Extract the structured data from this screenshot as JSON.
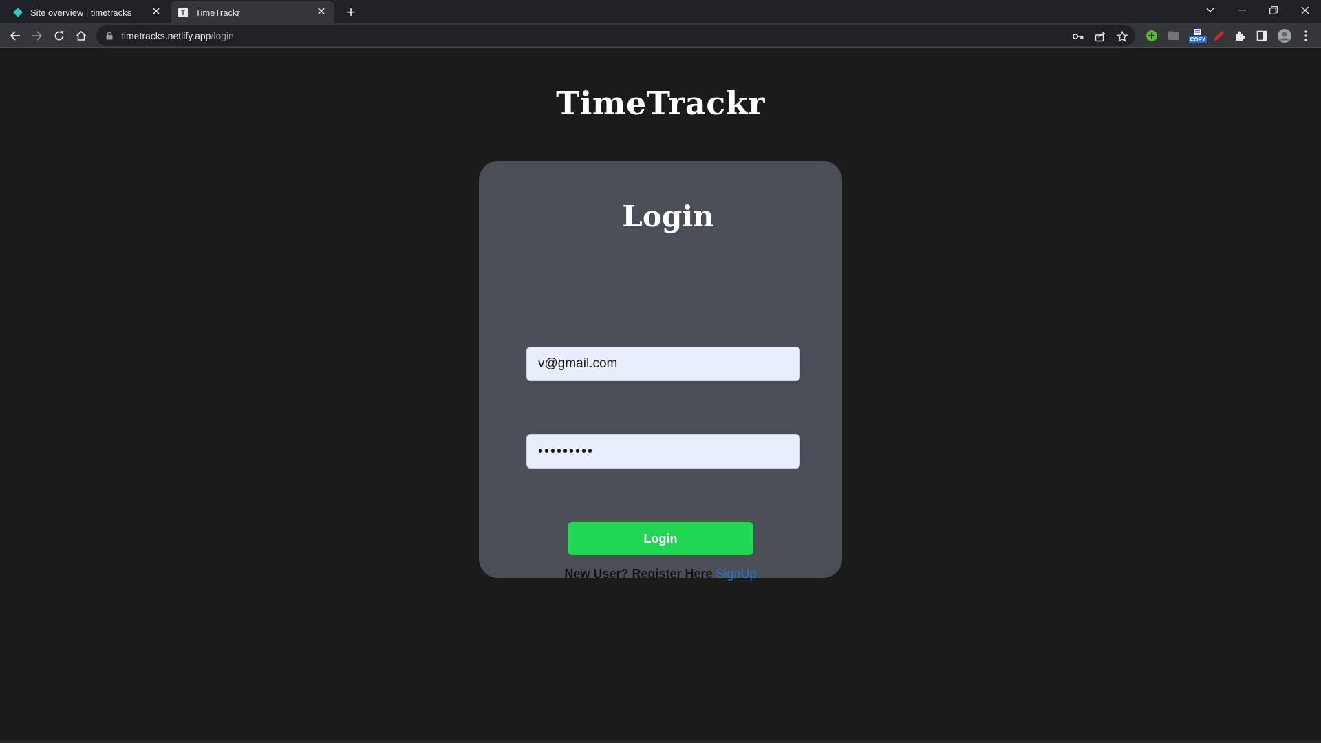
{
  "browser": {
    "tabs": [
      {
        "title": "Site overview | timetracks",
        "favicon": "netlify-diamond-icon",
        "active": false
      },
      {
        "title": "TimeTrackr",
        "favicon": "page-icon",
        "active": true
      }
    ],
    "new_tab": "+",
    "url": {
      "host": "timetracks.netlify.app",
      "path": "/login"
    }
  },
  "page": {
    "app_title": "TimeTrackr",
    "login_card": {
      "title": "Login",
      "email_value": "v@gmail.com",
      "password_value": "•••••••••",
      "submit_label": "Login",
      "register_prompt": "New User? Register Here ",
      "register_link": "SignUp"
    }
  },
  "colors": {
    "background": "#1b1b1b",
    "card": "#4a4f57",
    "input": "#e8eefb",
    "button": "#22d655",
    "link": "#2f6fe0"
  }
}
